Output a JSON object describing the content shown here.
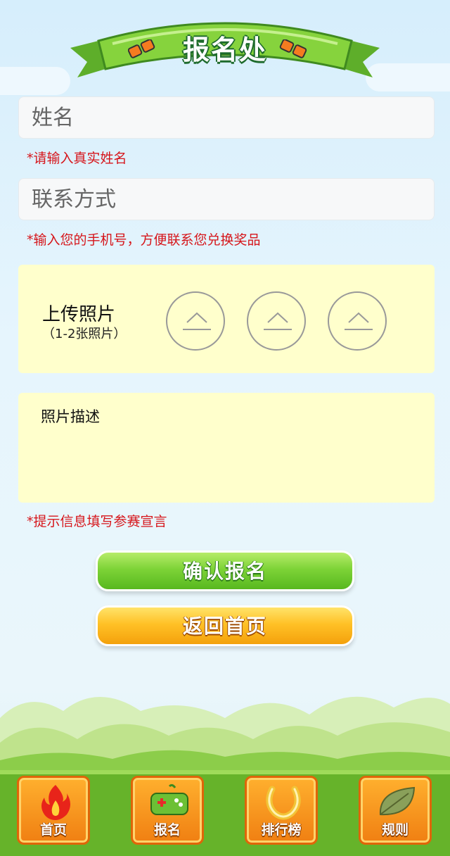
{
  "banner": {
    "title": "报名处"
  },
  "form": {
    "name_placeholder": "姓名",
    "name_hint": "*请输入真实姓名",
    "contact_placeholder": "联系方式",
    "contact_hint": "*输入您的手机号，方便联系您兑换奖品",
    "upload": {
      "title": "上传照片",
      "subtitle": "（1-2张照片）",
      "slots": 3
    },
    "description_label": "照片描述",
    "description_hint": "*提示信息填写参赛宣言"
  },
  "buttons": {
    "confirm": "确认报名",
    "back": "返回首页"
  },
  "nav": [
    {
      "label": "首页",
      "icon": "fire-icon"
    },
    {
      "label": "报名",
      "icon": "gamepad-icon"
    },
    {
      "label": "排行榜",
      "icon": "horseshoe-icon"
    },
    {
      "label": "规则",
      "icon": "leaf-icon"
    }
  ],
  "colors": {
    "hint": "#d6161b",
    "panel": "#ffffcc",
    "green": "#7dd337",
    "orange": "#ffc126"
  }
}
